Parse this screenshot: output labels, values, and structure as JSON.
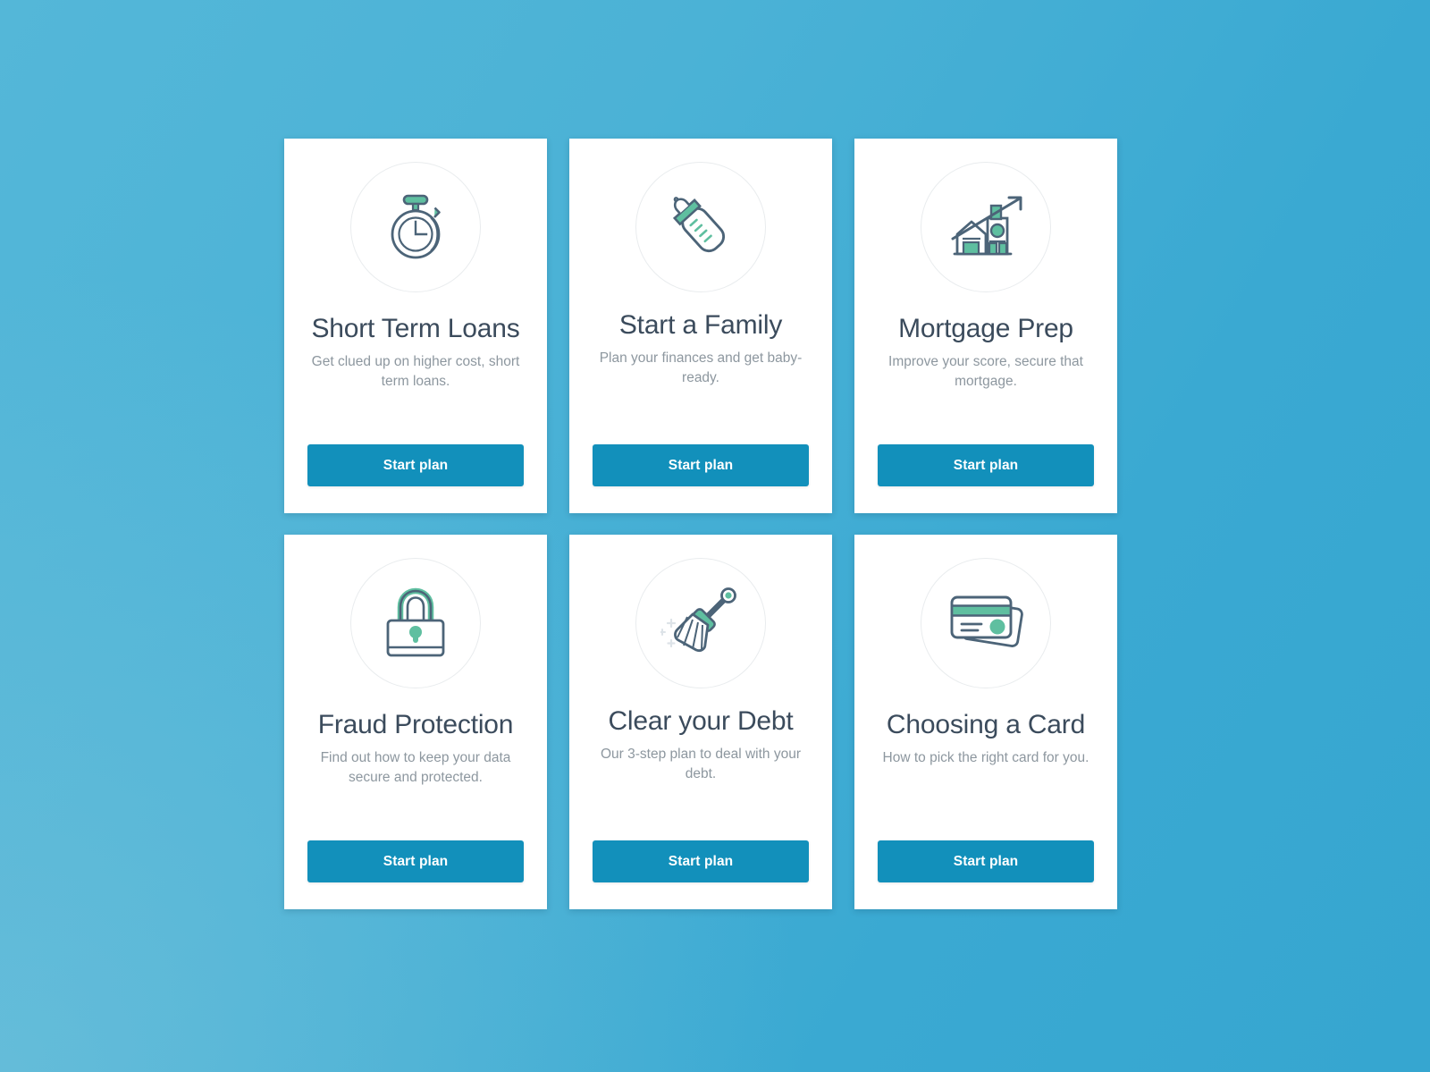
{
  "page": {
    "background_color_start": "#54b7d8",
    "background_color_end": "#36a6d0",
    "accent_button_color": "#1290bb",
    "title_color": "#3b4b5c",
    "description_color": "#8d979f",
    "icon_outline_color": "#4c6478",
    "icon_accent_color": "#5fbfa0"
  },
  "cards": [
    {
      "id": "short-term-loans",
      "icon": "stopwatch-icon",
      "title": "Short Term Loans",
      "description": "Get clued up on higher cost, short term loans.",
      "button_label": "Start plan"
    },
    {
      "id": "start-a-family",
      "icon": "baby-bottle-icon",
      "title": "Start a Family",
      "description": "Plan your finances and get baby-ready.",
      "button_label": "Start plan"
    },
    {
      "id": "mortgage-prep",
      "icon": "house-growth-chart-icon",
      "title": "Mortgage Prep",
      "description": "Improve your score, secure that mortgage.",
      "button_label": "Start plan"
    },
    {
      "id": "fraud-protection",
      "icon": "padlock-icon",
      "title": "Fraud Protection",
      "description": "Find out how to keep your data secure and protected.",
      "button_label": "Start plan"
    },
    {
      "id": "clear-your-debt",
      "icon": "broom-icon",
      "title": "Clear your Debt",
      "description": "Our 3-step plan to deal with your debt.",
      "button_label": "Start plan"
    },
    {
      "id": "choosing-a-card",
      "icon": "credit-cards-icon",
      "title": "Choosing a Card",
      "description": "How to pick the right card for you.",
      "button_label": "Start plan"
    }
  ]
}
